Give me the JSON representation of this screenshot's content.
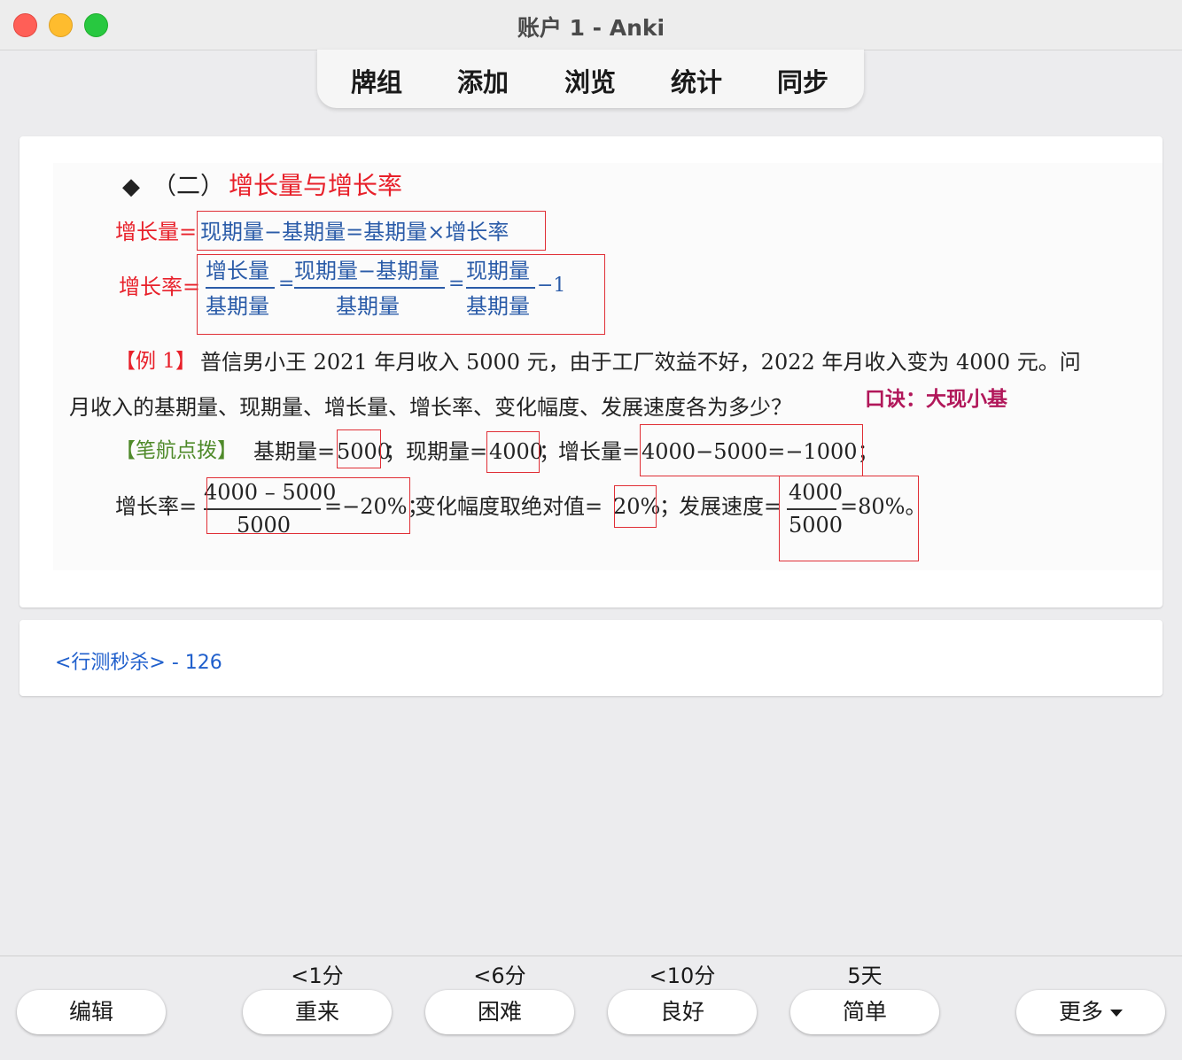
{
  "window": {
    "title": "账户 1 - Anki"
  },
  "toolbar": {
    "decks": "牌组",
    "add": "添加",
    "browse": "浏览",
    "stats": "统计",
    "sync": "同步"
  },
  "card": {
    "heading_prefix": "（二）",
    "heading_title": "增长量与增长率",
    "f1_label": "增长量=",
    "f1_body": "现期量−基期量=基期量×增长率",
    "f2_label": "增长率=",
    "f2_n1": "增长量",
    "f2_d1": "基期量",
    "f2_eq1": "=",
    "f2_n2": "现期量−基期量",
    "f2_d2": "基期量",
    "f2_eq2": "=",
    "f2_n3": "现期量",
    "f2_d3": "基期量",
    "f2_minus1": "−1",
    "ex_tag": "【例 1】",
    "ex_line1": "普信男小王 2021 年月收入 5000 元，由于工厂效益不好，2022 年月收入变为 4000 元。问",
    "ex_line2": "月收入的基期量、现期量、增长量、增长率、变化幅度、发展速度各为多少？",
    "mnemonic": "口诀：大现小基",
    "sol_tag": "【笔航点拨】",
    "sol_base_label": "基期量=",
    "sol_base_val": "5000",
    "sol_sep1": "；",
    "sol_cur_label": "现期量=",
    "sol_cur_val": "4000",
    "sol_sep2": "；",
    "sol_inc_label": "增长量=",
    "sol_inc_val": "4000−5000=−1000；",
    "rate_label": "增长率=",
    "rate_num": "4000 – 5000",
    "rate_den": "5000",
    "rate_res": "=−20%；",
    "amp_label": "变化幅度取绝对值=",
    "amp_val": "20%",
    "amp_sep": "；",
    "speed_label": "发展速度=",
    "speed_num": "4000",
    "speed_den": "5000",
    "speed_res": "=80%。"
  },
  "tags": {
    "text": "<行测秒杀> - 126"
  },
  "answers": {
    "edit": "编辑",
    "again_interval": "<1分",
    "again": "重来",
    "hard_interval": "<6分",
    "hard": "困难",
    "good_interval": "<10分",
    "good": "良好",
    "easy_interval": "5天",
    "easy": "简单",
    "more": "更多"
  }
}
